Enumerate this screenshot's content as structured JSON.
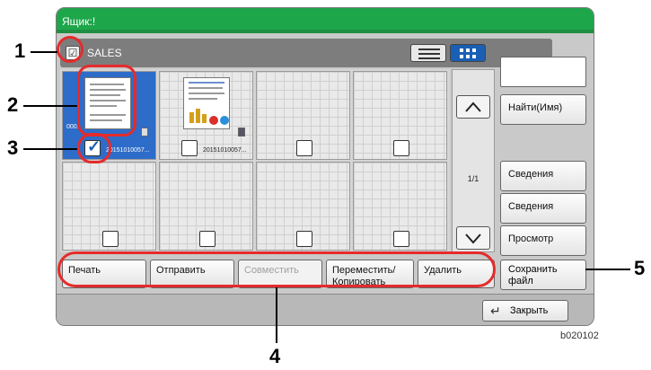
{
  "window": {
    "title": "Ящик:!"
  },
  "folder": {
    "name": "SALES"
  },
  "files": [
    {
      "name": "20151010105 7...",
      "display": "20151010057...",
      "number": "0001",
      "selected": true
    },
    {
      "name": "20151010105 7...",
      "display": "20151010057...",
      "selected": false
    }
  ],
  "pager": {
    "text": "1/1",
    "up": "^",
    "down": "v"
  },
  "right_buttons": {
    "find": "Найти(Имя)",
    "details1": "Сведения",
    "details2": "Сведения",
    "preview": "Просмотр",
    "save": "Сохранить файл"
  },
  "bottom_buttons": {
    "print": "Печать",
    "send": "Отправить",
    "combine": "Совместить",
    "move": "Переместить/ Копировать",
    "delete": "Удалить"
  },
  "close_label": "Закрыть",
  "callouts": [
    "1",
    "2",
    "3",
    "4",
    "5"
  ],
  "figure_id": "b020102",
  "colors": {
    "title_green": "#1ea64b",
    "selected_blue": "#2d6cc9",
    "ring_red": "#e52b2b"
  }
}
